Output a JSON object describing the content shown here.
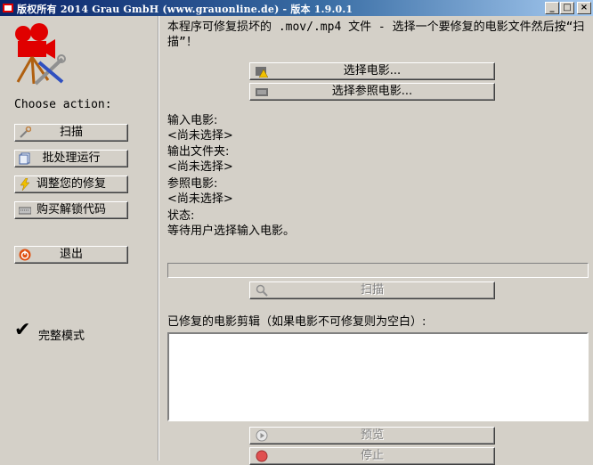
{
  "window": {
    "title": "版权所有 2014 Grau GmbH (www.grauonline.de) - 版本 1.9.0.1",
    "controls": {
      "minimize": "_",
      "maximize": "□",
      "close": "×"
    }
  },
  "sidebar": {
    "choose_label": "Choose action:",
    "buttons": [
      {
        "label": "扫描",
        "icon": "wrench-icon"
      },
      {
        "label": "批处理运行",
        "icon": "batch-icon"
      },
      {
        "label": "调整您的修复",
        "icon": "lightning-icon"
      },
      {
        "label": "购买解锁代码",
        "icon": "keyboard-icon"
      },
      {
        "label": "退出",
        "icon": "power-icon"
      }
    ],
    "full_mode_check": "✔",
    "full_mode_label": "完整模式"
  },
  "main": {
    "intro": "本程序可修复损坏的 .mov/.mp4 文件 - 选择一个要修复的电影文件然后按“扫描”！",
    "select_movie_button": "选择电影...",
    "select_reference_button": "选择参照电影...",
    "input_movie_label": "输入电影:",
    "input_movie_value": "<尚未选择>",
    "output_folder_label": "输出文件夹:",
    "output_folder_value": "<尚未选择>",
    "reference_movie_label": "参照电影:",
    "reference_movie_value": "<尚未选择>",
    "status_label": "状态:",
    "status_value": "等待用户选择输入电影。",
    "progress": 0,
    "scan_button": "扫描",
    "repaired_label": "已修复的电影剪辑（如果电影不可修复则为空白）:",
    "repaired_clips": [],
    "preview_button": "预览",
    "stop_button": "停止"
  },
  "colors": {
    "face": "#d4d0c8",
    "title_start": "#0a246a",
    "title_end": "#a6caf0",
    "logo_red": "#e00000",
    "disabled_text": "#808080"
  }
}
